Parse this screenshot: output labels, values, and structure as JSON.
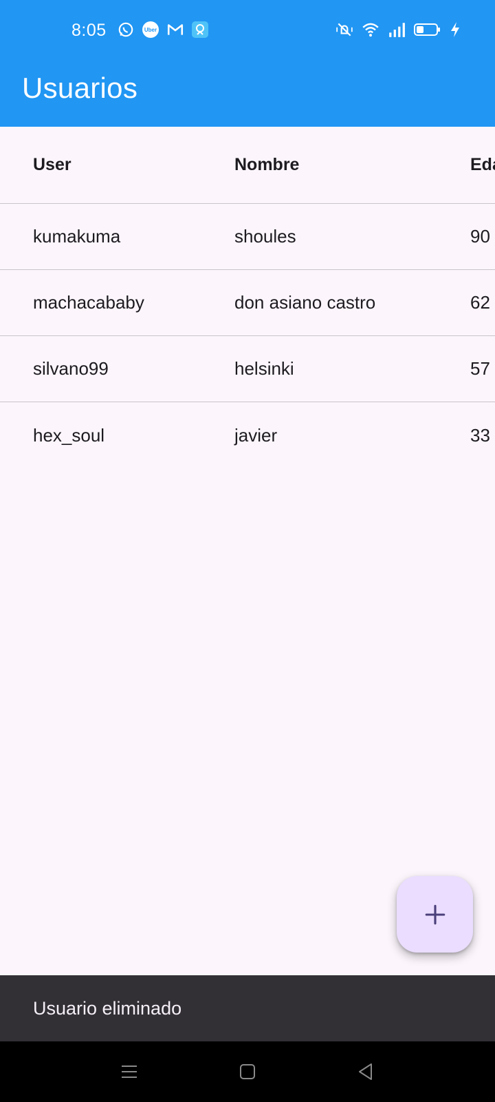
{
  "status_bar": {
    "time": "8:05",
    "left_icons": [
      "whatsapp-icon",
      "uber-icon",
      "gmail-icon",
      "app-tile-icon"
    ],
    "right_icons": [
      "vibrate-icon",
      "wifi-icon",
      "signal-icon",
      "battery-icon",
      "charging-icon"
    ],
    "uber_text": "Uber"
  },
  "app_bar": {
    "title": "Usuarios",
    "color": "#2196F3"
  },
  "table": {
    "columns": [
      "User",
      "Nombre",
      "Eda"
    ],
    "rows": [
      {
        "user": "kumakuma",
        "nombre": "shoules",
        "edad": "90"
      },
      {
        "user": "machacababy",
        "nombre": "don asiano castro",
        "edad": "62"
      },
      {
        "user": "silvano99",
        "nombre": "helsinki",
        "edad": "57"
      },
      {
        "user": "hex_soul",
        "nombre": "javier",
        "edad": "33"
      }
    ]
  },
  "fab": {
    "icon": "add-icon",
    "background": "#EADDFF",
    "icon_color": "#4A3F7A"
  },
  "snackbar": {
    "message": "Usuario eliminado"
  },
  "nav_bar": {
    "buttons": [
      "menu-icon",
      "home-icon",
      "back-icon"
    ]
  }
}
